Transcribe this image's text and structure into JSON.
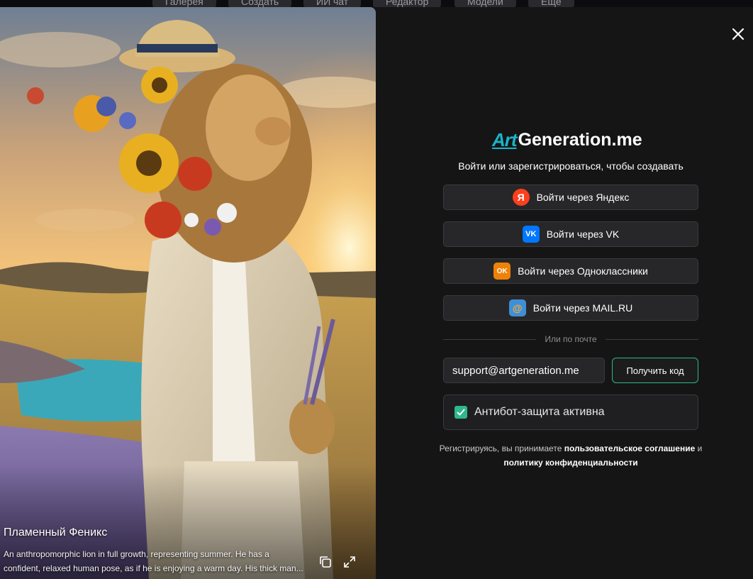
{
  "nav": {
    "tabs": [
      "Галерея",
      "Создать",
      "ИИ чат",
      "Редактор",
      "Модели",
      "Ещё"
    ]
  },
  "artwork": {
    "title": "Пламенный Феникс",
    "description": "An anthropomorphic lion in full growth, representing summer. He has a confident, relaxed human pose, as if he is enjoying a warm day. His thick man..."
  },
  "logo": {
    "mark": "Art",
    "name": "Generation.me"
  },
  "login": {
    "subtitle": "Войти или зарегистрироваться, чтобы создавать",
    "buttons": [
      {
        "label": "Войти через Яндекс",
        "icon": "yandex-icon",
        "icon_text": "Я",
        "color": "#fc3f1d"
      },
      {
        "label": "Войти через VK",
        "icon": "vk-icon",
        "icon_text": "VK",
        "color": "#0077ff"
      },
      {
        "label": "Войти через Одноклассники",
        "icon": "odnoklassniki-icon",
        "icon_text": "OK",
        "color": "#ee8208"
      },
      {
        "label": "Войти через MAIL.RU",
        "icon": "mailru-icon",
        "icon_text": "@",
        "color": "#3e8fd8"
      }
    ],
    "divider": "Или по почте",
    "email_value": "support@artgeneration.me",
    "get_code": "Получить код",
    "antibot": "Антибот-защита активна",
    "terms_prefix": "Регистрируясь, вы принимаете",
    "terms_link": "пользовательское соглашение",
    "terms_and": "и",
    "privacy_link": "политику конфиденциальности"
  },
  "colors": {
    "accent": "#2fb88a",
    "background": "#151516",
    "button_bg": "#272729"
  }
}
